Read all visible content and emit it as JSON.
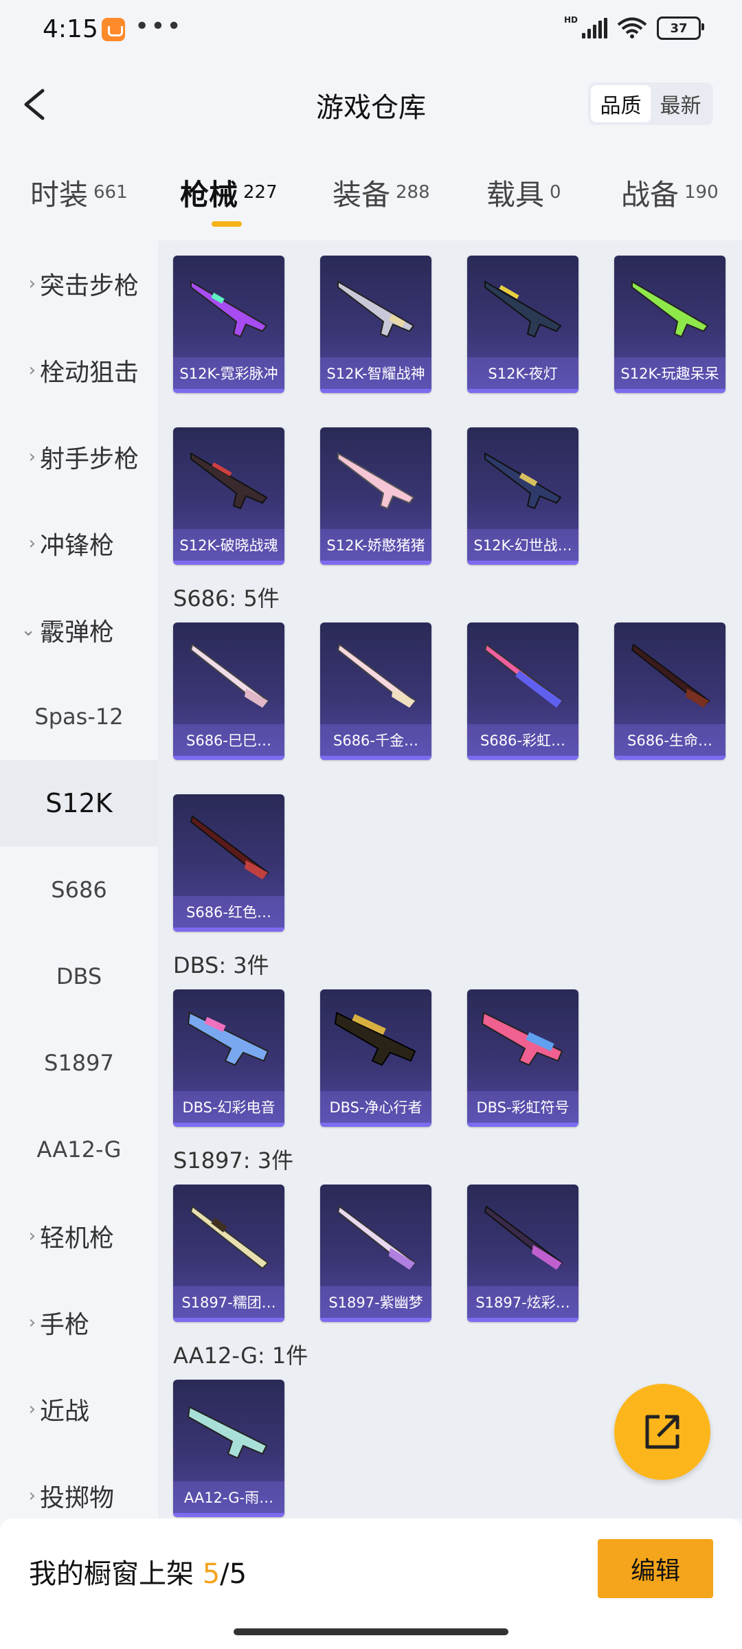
{
  "status": {
    "time": "4:15",
    "battery": "37",
    "hd": "HD"
  },
  "header": {
    "title": "游戏仓库",
    "sort_options": [
      "品质",
      "最新"
    ]
  },
  "tabs": [
    {
      "label": "时装",
      "count": "661"
    },
    {
      "label": "枪械",
      "count": "227"
    },
    {
      "label": "装备",
      "count": "288"
    },
    {
      "label": "载具",
      "count": "0"
    },
    {
      "label": "战备",
      "count": "190"
    }
  ],
  "sidebar": {
    "items": [
      "突击步枪",
      "栓动狙击",
      "射手步枪",
      "冲锋枪",
      "霰弹枪"
    ],
    "subitems": [
      "Spas-12",
      "S12K",
      "S686",
      "DBS",
      "S1897",
      "AA12-G"
    ],
    "items_after": [
      "轻机枪",
      "手枪",
      "近战",
      "投掷物"
    ]
  },
  "groups": {
    "s12k": {
      "items": [
        "S12K-霓彩脉冲",
        "S12K-智耀战神",
        "S12K-夜灯",
        "S12K-玩趣呆呆",
        "S12K-破晓战魂",
        "S12K-娇憨猪猪",
        "S12K-幻世战…"
      ]
    },
    "s686": {
      "title": "S686: 5件",
      "items": [
        "S686-巳巳…",
        "S686-千金…",
        "S686-彩虹…",
        "S686-生命…",
        "S686-红色…"
      ]
    },
    "dbs": {
      "title": "DBS: 3件",
      "items": [
        "DBS-幻彩电音",
        "DBS-净心行者",
        "DBS-彩虹符号"
      ]
    },
    "s1897": {
      "title": "S1897: 3件",
      "items": [
        "S1897-糯团…",
        "S1897-紫幽梦",
        "S1897-炫彩…"
      ]
    },
    "aa12g": {
      "title": "AA12-G: 1件",
      "items": [
        "AA12-G-雨…"
      ]
    }
  },
  "bottom": {
    "showcase_label": "我的橱窗上架",
    "showcase_current": "5",
    "showcase_sep": "/",
    "showcase_total": "5",
    "edit_label": "编辑"
  },
  "colors": {
    "accent": "#f5a51b",
    "card_top": "#2a2a57",
    "card_bottom": "#5047a0"
  }
}
